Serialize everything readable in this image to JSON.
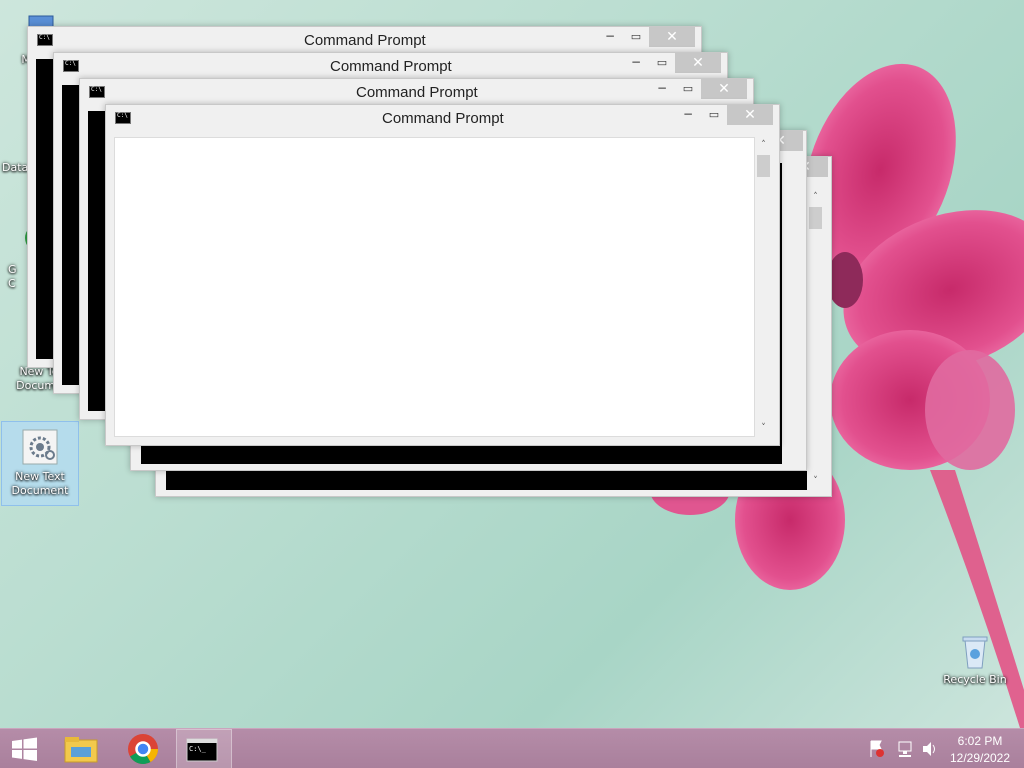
{
  "desktop": {
    "icons": [
      {
        "label": "My C",
        "icon": "computer-icon"
      },
      {
        "label": "Data",
        "icon": "shortcut-icon"
      },
      {
        "label": "G C",
        "icon": "chrome-shortcut-icon"
      },
      {
        "label": "New Te Docume",
        "icon": "text-document-icon"
      },
      {
        "label": "New Text Document",
        "icon": "settings-document-icon"
      },
      {
        "label": "Recycle Bin",
        "icon": "recycle-bin-icon"
      }
    ]
  },
  "windows": [
    {
      "title": "Command Prompt",
      "minimize": "−",
      "maximize": "▭",
      "close": "✕"
    },
    {
      "title": "Command Prompt",
      "minimize": "−",
      "maximize": "▭",
      "close": "✕"
    },
    {
      "title": "Command Prompt",
      "minimize": "−",
      "maximize": "▭",
      "close": "✕"
    },
    {
      "title": "Command Prompt",
      "minimize": "−",
      "maximize": "▭",
      "close": "✕"
    },
    {
      "title": "",
      "minimize": "",
      "maximize": "",
      "close": "✕"
    },
    {
      "title": "",
      "minimize": "",
      "maximize": "",
      "close": "✕"
    }
  ],
  "scroll": {
    "up": "˄",
    "down": "˅"
  },
  "taskbar": {
    "start_icon": "windows-logo-icon",
    "pinned": [
      "file-explorer-icon",
      "chrome-icon",
      "command-prompt-icon"
    ],
    "tray": {
      "time": "6:02 PM",
      "date": "12/29/2022",
      "icons": [
        "action-center-flag-icon",
        "network-icon",
        "volume-icon"
      ]
    }
  },
  "colors": {
    "taskbar": "#a9809c",
    "flower": "#d63a78",
    "close_button": "#c7c7c7"
  }
}
